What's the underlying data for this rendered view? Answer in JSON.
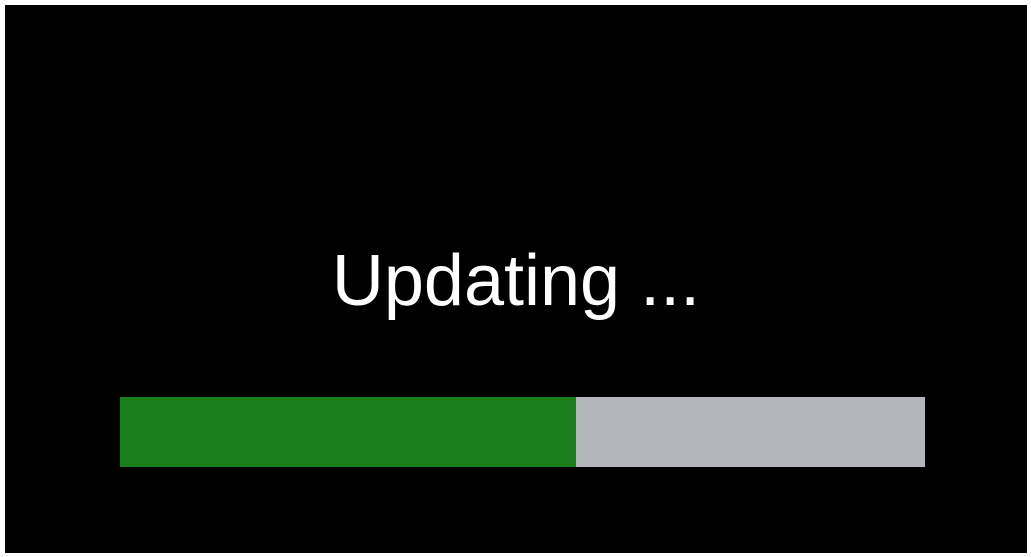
{
  "status": {
    "message": "Updating ..."
  },
  "progress": {
    "fraction": 0.567,
    "fill_color": "#1b801b",
    "track_color": "#b5b5bd"
  },
  "colors": {
    "background": "#000000",
    "text": "#ffffff"
  }
}
